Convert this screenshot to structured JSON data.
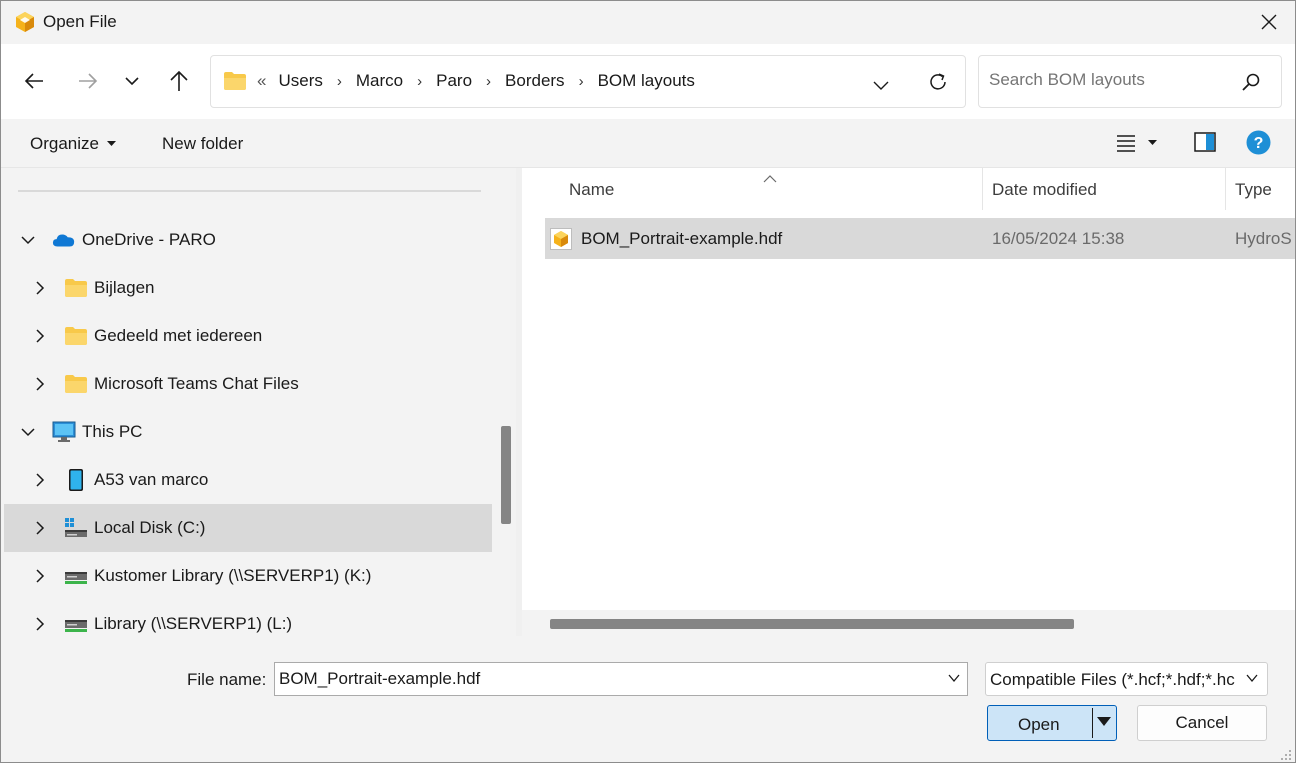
{
  "window": {
    "title": "Open File",
    "icon": "hydroshop-cube-icon"
  },
  "nav": {
    "back": "back-arrow-icon",
    "forward": "forward-arrow-icon",
    "recent": "chevron-down-icon",
    "up": "up-arrow-icon"
  },
  "address": {
    "overflow": "«",
    "crumbs": [
      "Users",
      "Marco",
      "Paro",
      "Borders",
      "BOM layouts"
    ]
  },
  "search": {
    "placeholder": "Search BOM layouts"
  },
  "toolbar": {
    "organize": "Organize",
    "new_folder": "New folder"
  },
  "tree": [
    {
      "label": "OneDrive - PARO",
      "icon": "cloud-icon",
      "level": 0,
      "expanded": true
    },
    {
      "label": "Bijlagen",
      "icon": "folder-icon",
      "level": 1
    },
    {
      "label": "Gedeeld met iedereen",
      "icon": "folder-icon",
      "level": 1
    },
    {
      "label": "Microsoft Teams Chat Files",
      "icon": "folder-icon",
      "level": 1
    },
    {
      "label": "This PC",
      "icon": "monitor-icon",
      "level": 0,
      "expanded": true
    },
    {
      "label": "A53 van marco",
      "icon": "phone-icon",
      "level": 1
    },
    {
      "label": "Local Disk (C:)",
      "icon": "drive-icon",
      "level": 1,
      "selected": true
    },
    {
      "label": "Kustomer Library (\\\\SERVERP1) (K:)",
      "icon": "network-drive-icon",
      "level": 1
    },
    {
      "label": "Library (\\\\SERVERP1) (L:)",
      "icon": "network-drive-icon",
      "level": 1
    }
  ],
  "columns": {
    "name": "Name",
    "date": "Date modified",
    "type": "Type"
  },
  "files": [
    {
      "name": "BOM_Portrait-example.hdf",
      "date": "16/05/2024 15:38",
      "type": "HydroS"
    }
  ],
  "footer": {
    "file_name_label": "File name:",
    "file_name_value": "BOM_Portrait-example.hdf",
    "file_type": "Compatible Files (*.hcf;*.hdf;*.hc",
    "open": "Open",
    "cancel": "Cancel"
  },
  "colors": {
    "accent": "#005fb8",
    "selected": "#d9d9d9",
    "help": "#1e8fd6"
  }
}
